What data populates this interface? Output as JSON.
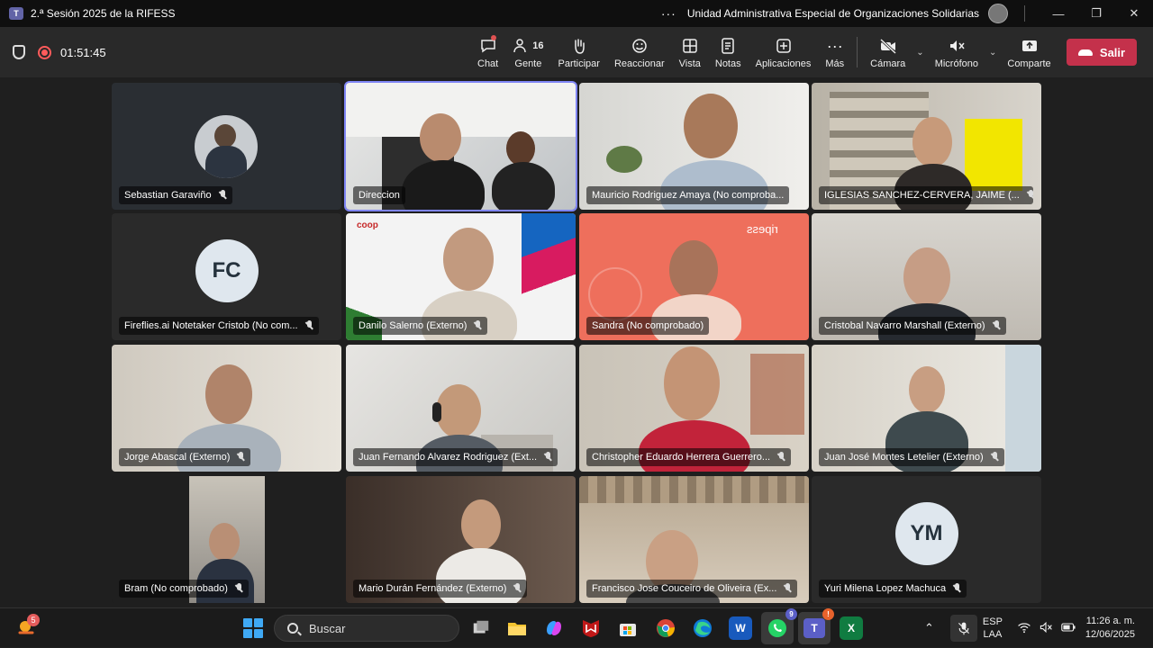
{
  "window": {
    "title": "2.ª Sesión 2025 de la RIFESS",
    "organization": "Unidad Administrativa Especial de Organizaciones Solidarias",
    "more": "···"
  },
  "toolbar": {
    "timer": "01:51:45",
    "items": [
      {
        "label": "Chat",
        "icon": "chat-icon"
      },
      {
        "label": "Gente",
        "icon": "people-icon",
        "count": "16"
      },
      {
        "label": "Participar",
        "icon": "raise-hand-icon"
      },
      {
        "label": "Reaccionar",
        "icon": "reaction-icon"
      },
      {
        "label": "Vista",
        "icon": "view-grid-icon"
      },
      {
        "label": "Notas",
        "icon": "notes-icon"
      },
      {
        "label": "Aplicaciones",
        "icon": "add-apps-icon"
      },
      {
        "label": "Más",
        "icon": "more-icon"
      }
    ],
    "camera_label": "Cámara",
    "mic_label": "Micrófono",
    "share_label": "Comparte",
    "leave_label": "Salir"
  },
  "participants": [
    {
      "name": "Sebastian Garaviño",
      "muted": true
    },
    {
      "name": "Direccion",
      "muted": false
    },
    {
      "name": "Mauricio Rodriguez Amaya (No comproba...",
      "muted": false
    },
    {
      "name": "IGLESIAS SANCHEZ-CERVERA, JAIME (...",
      "muted": true
    },
    {
      "name": "Fireflies.ai Notetaker Cristob (No com...",
      "muted": true,
      "initials": "FC"
    },
    {
      "name": "Danilo Salerno (Externo)",
      "muted": true
    },
    {
      "name": "Sandra (No comprobado)",
      "muted": false
    },
    {
      "name": "Cristobal Navarro Marshall (Externo)",
      "muted": true
    },
    {
      "name": "Jorge Abascal (Externo)",
      "muted": true
    },
    {
      "name": "Juan Fernando Alvarez Rodriguez (Ext...",
      "muted": true
    },
    {
      "name": "Christopher Eduardo Herrera Guerrero...",
      "muted": true
    },
    {
      "name": "Juan José Montes Letelier (Externo)",
      "muted": true
    },
    {
      "name": "Bram (No comprobado)",
      "muted": true
    },
    {
      "name": "Mario Durán Fernández (Externo)",
      "muted": true
    },
    {
      "name": "Francisco Jose Couceiro de Oliveira (Ex...",
      "muted": true
    },
    {
      "name": "Yuri Milena Lopez Machuca",
      "muted": true,
      "initials": "YM"
    }
  ],
  "tile_text": {
    "coop": "coop",
    "ripess": "ripess"
  },
  "taskbar": {
    "weather_badge": "5",
    "search_placeholder": "Buscar",
    "whatsapp_badge": "9",
    "teams_badge": "!",
    "language_top": "ESP",
    "language_bottom": "LAA",
    "time": "11:26 a. m.",
    "date": "12/06/2025"
  },
  "colors": {
    "accent": "#7f85f5",
    "leave": "#c4314b",
    "toolbar": "#292929",
    "stage": "#1f1f1f"
  }
}
